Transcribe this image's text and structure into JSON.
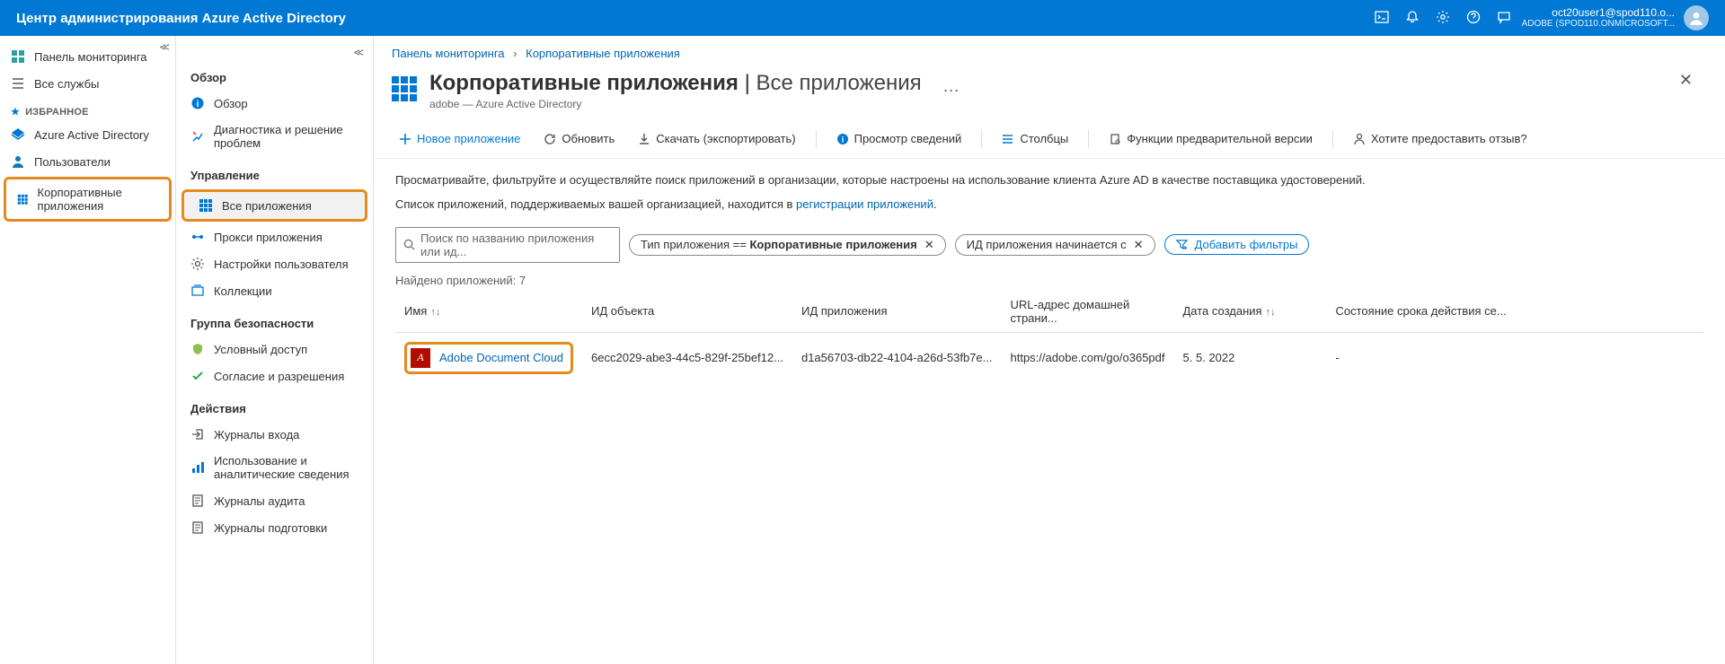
{
  "header": {
    "title": "Центр администрирования Azure Active Directory",
    "user_line1": "oct20user1@spod110.o...",
    "user_line2": "ADOBE (SPOD110.ONMICROSOFT..."
  },
  "sidebar": {
    "items": [
      {
        "label": "Панель мониторинга"
      },
      {
        "label": "Все службы"
      }
    ],
    "favorites_heading": "ИЗБРАННОЕ",
    "favorites": [
      {
        "label": "Azure Active Directory"
      },
      {
        "label": "Пользователи"
      },
      {
        "label": "Корпоративные приложения"
      }
    ]
  },
  "secondary": {
    "overview_heading": "Обзор",
    "overview_items": [
      {
        "label": "Обзор"
      },
      {
        "label": "Диагностика и решение проблем"
      }
    ],
    "manage_heading": "Управление",
    "manage_items": [
      {
        "label": "Все приложения"
      },
      {
        "label": "Прокси приложения"
      },
      {
        "label": "Настройки пользователя"
      },
      {
        "label": "Коллекции"
      }
    ],
    "security_heading": "Группа безопасности",
    "security_items": [
      {
        "label": "Условный доступ"
      },
      {
        "label": "Согласие и разрешения"
      }
    ],
    "actions_heading": "Действия",
    "actions_items": [
      {
        "label": "Журналы входа"
      },
      {
        "label": "Использование и аналитические сведения"
      },
      {
        "label": "Журналы аудита"
      },
      {
        "label": "Журналы подготовки"
      }
    ]
  },
  "breadcrumb": {
    "a": "Панель мониторинга",
    "b": "Корпоративные приложения"
  },
  "page": {
    "title_bold": "Корпоративные приложения",
    "title_thin": "Все приложения",
    "subtitle": "adobe — Azure Active Directory"
  },
  "toolbar": {
    "new_app": "Новое приложение",
    "refresh": "Обновить",
    "download": "Скачать (экспортировать)",
    "preview_info": "Просмотр сведений",
    "columns": "Столбцы",
    "preview_features": "Функции предварительной версии",
    "feedback": "Хотите предоставить отзыв?"
  },
  "info": {
    "line1": "Просматривайте, фильтруйте и осуществляйте поиск приложений в организации, которые настроены на использование клиента Azure AD в качестве поставщика удостоверений.",
    "line2_prefix": "Список приложений, поддерживаемых вашей организацией, находится в ",
    "line2_link": "регистрации приложений",
    "line2_suffix": "."
  },
  "filters": {
    "search_placeholder": "Поиск по названию приложения или ид...",
    "pill1_label": "Тип приложения ==",
    "pill1_value": "Корпоративные приложения",
    "pill2_label": "ИД приложения начинается с",
    "add_label": "Добавить фильтры"
  },
  "found_label": "Найдено приложений: 7",
  "table": {
    "cols": [
      "Имя",
      "ИД объекта",
      "ИД приложения",
      "URL-адрес домашней страни...",
      "Дата создания",
      "Состояние срока действия се..."
    ],
    "rows": [
      {
        "name": "Adobe Document Cloud",
        "object_id": "6ecc2029-abe3-44c5-829f-25bef12...",
        "app_id": "d1a56703-db22-4104-a26d-53fb7e...",
        "url": "https://adobe.com/go/o365pdf",
        "created": "5. 5. 2022",
        "cert": "-"
      }
    ]
  }
}
